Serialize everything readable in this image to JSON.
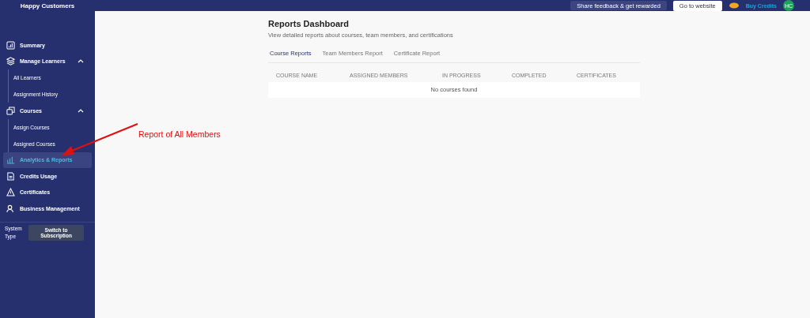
{
  "brand": "Happy Customers",
  "header": {
    "feedback_button": "Share feedback & get rewarded",
    "website_button": "Go to website",
    "buy_credits": "Buy Credits",
    "avatar": "HC"
  },
  "sidebar": {
    "items": [
      {
        "label": "Summary",
        "selected": false
      },
      {
        "label": "Manage Learners",
        "selected": false,
        "expanded": true,
        "children": [
          {
            "label": "All Learners",
            "selected": false
          },
          {
            "label": "Assignment History",
            "selected": false
          }
        ]
      },
      {
        "label": "Courses",
        "selected": false,
        "expanded": true,
        "children": [
          {
            "label": "Assign Courses",
            "selected": false
          },
          {
            "label": "Assigned Courses",
            "selected": false
          }
        ]
      },
      {
        "label": "Analytics & Reports",
        "selected": true
      },
      {
        "label": "Credits Usage",
        "selected": false
      },
      {
        "label": "Certificates",
        "selected": false
      },
      {
        "label": "Business Management",
        "selected": false
      }
    ],
    "system_type_label": "System Type",
    "switch_button": "Switch to Subscription"
  },
  "page": {
    "title": "Reports Dashboard",
    "subtitle": "View detailed reports about courses, team members, and certifications",
    "tabs": [
      {
        "label": "Course Reports",
        "selected": true
      },
      {
        "label": "Team Members Report",
        "selected": false
      },
      {
        "label": "Certificate Report",
        "selected": false
      }
    ],
    "table": {
      "columns": [
        "COURSE NAME",
        "ASSIGNED MEMBERS",
        "IN PROGRESS",
        "COMPLETED",
        "CERTIFICATES"
      ],
      "empty_message": "No courses found"
    }
  },
  "annotation": {
    "text": "Report of All Members"
  }
}
